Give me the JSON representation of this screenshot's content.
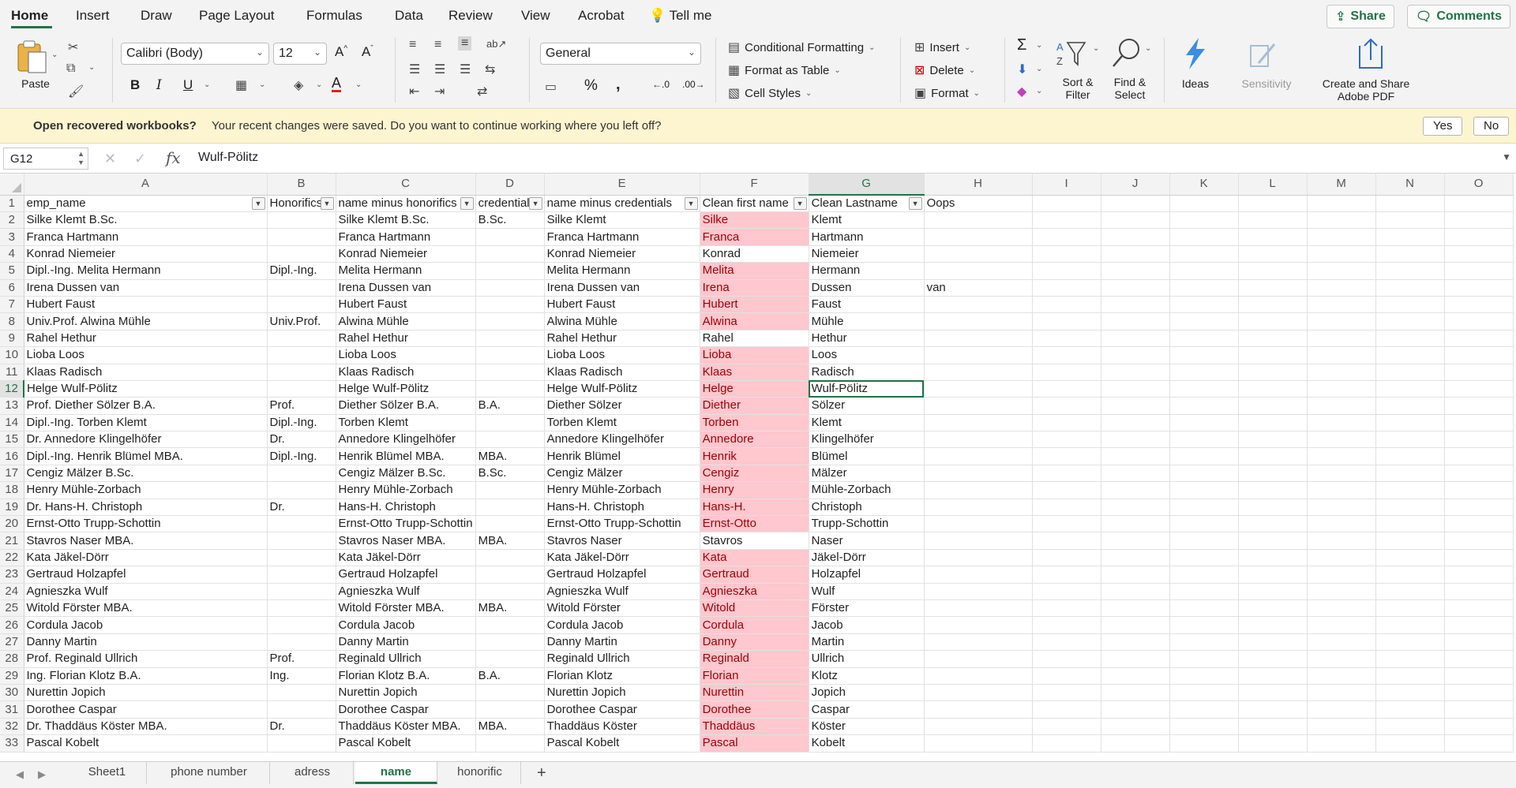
{
  "ribbon_tabs": [
    "Home",
    "Insert",
    "Draw",
    "Page Layout",
    "Formulas",
    "Data",
    "Review",
    "View",
    "Acrobat",
    "Tell me"
  ],
  "share": "Share",
  "comments": "Comments",
  "ribbon": {
    "paste": "Paste",
    "font_name": "Calibri (Body)",
    "font_size": "12",
    "number_format": "General",
    "conditional_formatting": "Conditional Formatting",
    "format_as_table": "Format as Table",
    "cell_styles": "Cell Styles",
    "insert": "Insert",
    "delete": "Delete",
    "format": "Format",
    "sort_filter": "Sort &\nFilter",
    "find_select": "Find &\nSelect",
    "ideas": "Ideas",
    "sensitivity": "Sensitivity",
    "create_share": "Create and Share\nAdobe PDF"
  },
  "notification": {
    "title": "Open recovered workbooks?",
    "message": "Your recent changes were saved. Do you want to continue working where you left off?",
    "yes": "Yes",
    "no": "No"
  },
  "formula_bar": {
    "name_box": "G12",
    "fx": "fx",
    "value": "Wulf-Pölitz"
  },
  "columns": [
    "A",
    "B",
    "C",
    "D",
    "E",
    "F",
    "G",
    "H",
    "I",
    "J",
    "K",
    "L",
    "M",
    "N",
    "O"
  ],
  "header_row": [
    "emp_name",
    "Honorifics",
    "name minus honorifics",
    "credentials",
    "name minus credentials",
    "Clean first name",
    "Clean Lastname",
    "Oops"
  ],
  "rows": [
    [
      "Silke Klemt B.Sc.",
      "",
      "Silke Klemt B.Sc.",
      "B.Sc.",
      "Silke Klemt",
      "Silke",
      "Klemt",
      ""
    ],
    [
      "Franca Hartmann",
      "",
      "Franca Hartmann",
      "",
      "Franca Hartmann",
      "Franca",
      "Hartmann",
      ""
    ],
    [
      "Konrad Niemeier",
      "",
      "Konrad Niemeier",
      "",
      "Konrad Niemeier",
      "Konrad",
      "Niemeier",
      ""
    ],
    [
      "Dipl.-Ing. Melita Hermann",
      "Dipl.-Ing.",
      "Melita Hermann",
      "",
      "Melita Hermann",
      "Melita",
      "Hermann",
      ""
    ],
    [
      "Irena Dussen van",
      "",
      "Irena Dussen van",
      "",
      "Irena Dussen van",
      "Irena",
      "Dussen",
      "van"
    ],
    [
      "Hubert Faust",
      "",
      "Hubert Faust",
      "",
      "Hubert Faust",
      "Hubert",
      "Faust",
      ""
    ],
    [
      "Univ.Prof. Alwina Mühle",
      "Univ.Prof.",
      "Alwina Mühle",
      "",
      "Alwina Mühle",
      "Alwina",
      "Mühle",
      ""
    ],
    [
      "Rahel Hethur",
      "",
      "Rahel Hethur",
      "",
      "Rahel Hethur",
      "Rahel",
      "Hethur",
      ""
    ],
    [
      "Lioba Loos",
      "",
      "Lioba Loos",
      "",
      "Lioba Loos",
      "Lioba",
      "Loos",
      ""
    ],
    [
      "Klaas Radisch",
      "",
      "Klaas Radisch",
      "",
      "Klaas Radisch",
      "Klaas",
      "Radisch",
      ""
    ],
    [
      "Helge Wulf-Pölitz",
      "",
      "Helge Wulf-Pölitz",
      "",
      "Helge Wulf-Pölitz",
      "Helge",
      "Wulf-Pölitz",
      ""
    ],
    [
      "Prof. Diether Sölzer B.A.",
      "Prof.",
      "Diether Sölzer B.A.",
      "B.A.",
      "Diether Sölzer",
      "Diether",
      "Sölzer",
      ""
    ],
    [
      "Dipl.-Ing. Torben Klemt",
      "Dipl.-Ing.",
      "Torben Klemt",
      "",
      "Torben Klemt",
      "Torben",
      "Klemt",
      ""
    ],
    [
      "Dr. Annedore Klingelhöfer",
      "Dr.",
      "Annedore Klingelhöfer",
      "",
      "Annedore Klingelhöfer",
      "Annedore",
      "Klingelhöfer",
      ""
    ],
    [
      "Dipl.-Ing. Henrik Blümel MBA.",
      "Dipl.-Ing.",
      "Henrik Blümel MBA.",
      "MBA.",
      "Henrik Blümel",
      "Henrik",
      "Blümel",
      ""
    ],
    [
      "Cengiz Mälzer B.Sc.",
      "",
      "Cengiz Mälzer B.Sc.",
      "B.Sc.",
      "Cengiz Mälzer",
      "Cengiz",
      "Mälzer",
      ""
    ],
    [
      "Henry Mühle-Zorbach",
      "",
      "Henry Mühle-Zorbach",
      "",
      "Henry Mühle-Zorbach",
      "Henry",
      "Mühle-Zorbach",
      ""
    ],
    [
      "Dr. Hans-H. Christoph",
      "Dr.",
      "Hans-H. Christoph",
      "",
      "Hans-H. Christoph",
      "Hans-H.",
      "Christoph",
      ""
    ],
    [
      "Ernst-Otto Trupp-Schottin",
      "",
      "Ernst-Otto Trupp-Schottin",
      "",
      "Ernst-Otto Trupp-Schottin",
      "Ernst-Otto",
      "Trupp-Schottin",
      ""
    ],
    [
      "Stavros Naser MBA.",
      "",
      "Stavros Naser MBA.",
      "MBA.",
      "Stavros Naser",
      "Stavros",
      "Naser",
      ""
    ],
    [
      "Kata Jäkel-Dörr",
      "",
      "Kata Jäkel-Dörr",
      "",
      "Kata Jäkel-Dörr",
      "Kata",
      "Jäkel-Dörr",
      ""
    ],
    [
      "Gertraud Holzapfel",
      "",
      "Gertraud Holzapfel",
      "",
      "Gertraud Holzapfel",
      "Gertraud",
      "Holzapfel",
      ""
    ],
    [
      "Agnieszka Wulf",
      "",
      "Agnieszka Wulf",
      "",
      "Agnieszka Wulf",
      "Agnieszka",
      "Wulf",
      ""
    ],
    [
      "Witold Förster MBA.",
      "",
      "Witold Förster MBA.",
      "MBA.",
      "Witold Förster",
      "Witold",
      "Förster",
      ""
    ],
    [
      "Cordula Jacob",
      "",
      "Cordula Jacob",
      "",
      "Cordula Jacob",
      "Cordula",
      "Jacob",
      ""
    ],
    [
      "Danny Martin",
      "",
      "Danny Martin",
      "",
      "Danny Martin",
      "Danny",
      "Martin",
      ""
    ],
    [
      "Prof. Reginald Ullrich",
      "Prof.",
      "Reginald Ullrich",
      "",
      "Reginald Ullrich",
      "Reginald",
      "Ullrich",
      ""
    ],
    [
      "Ing. Florian Klotz B.A.",
      "Ing.",
      "Florian Klotz B.A.",
      "B.A.",
      "Florian Klotz",
      "Florian",
      "Klotz",
      ""
    ],
    [
      "Nurettin Jopich",
      "",
      "Nurettin Jopich",
      "",
      "Nurettin Jopich",
      "Nurettin",
      "Jopich",
      ""
    ],
    [
      "Dorothee Caspar",
      "",
      "Dorothee Caspar",
      "",
      "Dorothee Caspar",
      "Dorothee",
      "Caspar",
      ""
    ],
    [
      "Dr. Thaddäus Köster MBA.",
      "Dr.",
      "Thaddäus Köster MBA.",
      "MBA.",
      "Thaddäus Köster",
      "Thaddäus",
      "Köster",
      ""
    ],
    [
      "Pascal Kobelt",
      "",
      "Pascal Kobelt",
      "",
      "Pascal Kobelt",
      "Pascal",
      "Kobelt",
      ""
    ]
  ],
  "unhighlighted_first_name_rows": [
    4,
    9,
    21
  ],
  "active_cell": {
    "row": 12,
    "col": "G"
  },
  "sheet_tabs": [
    "Sheet1",
    "phone number",
    "adress",
    "name",
    "honorific"
  ],
  "active_sheet": "name",
  "colors": {
    "accent": "#217346",
    "highlight_fill": "#ffc7ce",
    "highlight_text": "#9c0006"
  }
}
